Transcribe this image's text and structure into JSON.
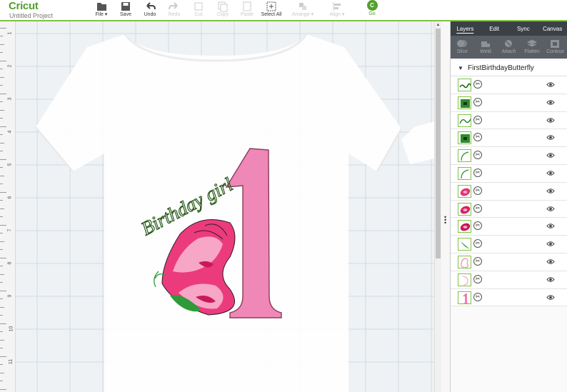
{
  "app": {
    "logo": "Cricut",
    "project_name": "Untitled Project"
  },
  "toolbar": {
    "file": "File",
    "save": "Save",
    "undo": "Undo",
    "redo": "Redo",
    "cut": "Cut",
    "copy": "Copy",
    "paste": "Paste",
    "select_all": "Select All",
    "arrange": "Arrange",
    "align": "Align",
    "go": "Go",
    "go_badge": "C"
  },
  "ruler": {
    "marks": [
      "1",
      "2",
      "3",
      "4",
      "5",
      "6",
      "7",
      "8",
      "9",
      "10",
      "11"
    ]
  },
  "panel": {
    "tabs": [
      {
        "label": "Layers",
        "active": true
      },
      {
        "label": "Edit",
        "active": false
      },
      {
        "label": "Sync",
        "active": false
      },
      {
        "label": "Canvas",
        "active": false
      }
    ],
    "tools": [
      "Slice",
      "Weld",
      "Attach",
      "Flatten",
      "Contour"
    ],
    "group_name": "FirstBirthdayButterfly",
    "layers": [
      {
        "thumb": "girl-text",
        "color": "#1e6b1e"
      },
      {
        "thumb": "green-square",
        "color": "#2f8a2f"
      },
      {
        "thumb": "birthday-text",
        "color": "#1e6b1e"
      },
      {
        "thumb": "green-square",
        "color": "#2f8a2f"
      },
      {
        "thumb": "green-stroke",
        "color": "#2f8a2f"
      },
      {
        "thumb": "green-stroke",
        "color": "#2f8a2f"
      },
      {
        "thumb": "pink-oval",
        "color": "#e4307a"
      },
      {
        "thumb": "pink-oval",
        "color": "#d81f64"
      },
      {
        "thumb": "pink-oval",
        "color": "#c81558"
      },
      {
        "thumb": "green-leaf",
        "color": "#2e9a3a"
      },
      {
        "thumb": "pink-butterfly",
        "color": "#f08fb5"
      },
      {
        "thumb": "pink-outline",
        "color": "#f5a7c6"
      },
      {
        "thumb": "pink-one",
        "color": "#f07fae"
      }
    ]
  },
  "design": {
    "text": "Birthday girl"
  },
  "colors": {
    "brand_green": "#52a12e",
    "accent_pink": "#ef7fad",
    "deep_pink": "#e23a7a",
    "dark_green": "#1f5a1f"
  }
}
